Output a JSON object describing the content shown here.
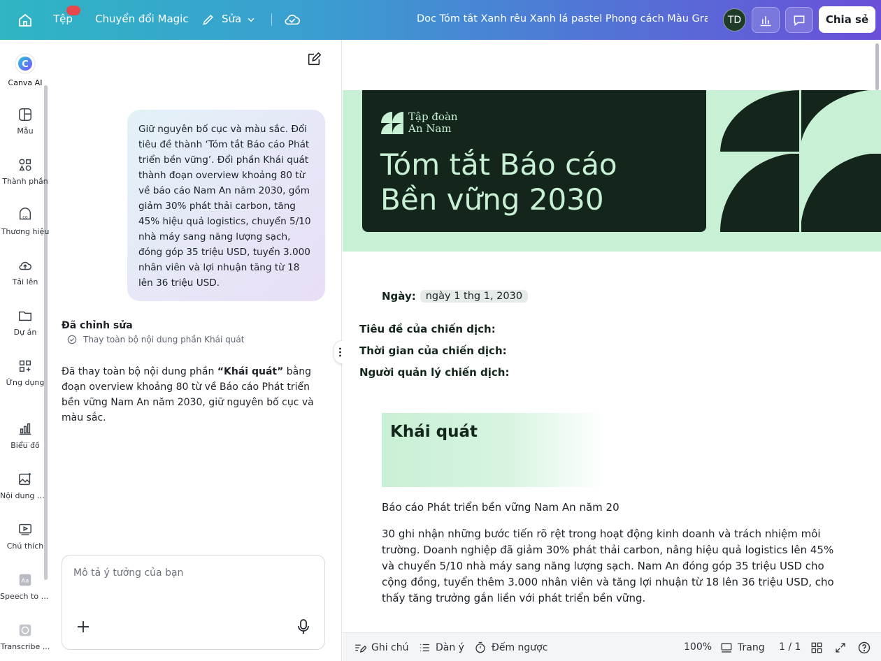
{
  "topbar": {
    "file": "Tệp",
    "magic": "Chuyển đổi Magic",
    "edit": "Sửa",
    "doc_title": "Doc Tóm tắt Xanh rêu Xanh lá pastel Phong cách Màu Gradi...",
    "avatar": "TD",
    "share": "Chia sẻ"
  },
  "rail": {
    "items": [
      {
        "label": "Canva AI"
      },
      {
        "label": "Mẫu"
      },
      {
        "label": "Thành phần"
      },
      {
        "label": "Thương hiệu"
      },
      {
        "label": "Tải lên"
      },
      {
        "label": "Dự án"
      },
      {
        "label": "Ứng dụng"
      },
      {
        "label": "Biểu đồ"
      },
      {
        "label": "Nội dung M..."
      },
      {
        "label": "Chú thích"
      },
      {
        "label": "Speech to T..."
      },
      {
        "label": "Transcribe ..."
      }
    ]
  },
  "chat": {
    "user_message": "Giữ nguyên bố cục và màu sắc. Đổi tiêu đề thành ‘Tóm tắt Báo cáo Phát triển bền vững’. Đổi phần Khái quát thành đoạn overview khoảng 80 từ về báo cáo Nam An năm 2030, gồm giảm 30% phát thải carbon, tăng 45% hiệu quả logistics, chuyển 5/10 nhà máy sang năng lượng sạch, đóng góp 35 triệu USD, tuyển 3.000 nhân viên và lợi nhuận tăng từ 18 lên 36 triệu USD.",
    "edited_title": "Đã chỉnh sửa",
    "edited_step": "Thay toàn bộ nội dung phần Khái quát",
    "reply_prefix": "Đã thay toàn bộ nội dung phần ",
    "reply_bold": "“Khái quát”",
    "reply_suffix": " bằng đoạn overview khoảng 80 từ về Báo cáo Phát triển bền vững Nam An năm 2030, giữ nguyên bố cục và màu sắc.",
    "composer_placeholder": "Mô tả ý tưởng của bạn"
  },
  "doc": {
    "company_line1": "Tập đoàn",
    "company_line2": "An Nam",
    "title_line1": "Tóm tắt Báo cáo",
    "title_line2": "Bền vững 2030",
    "date_label": "Ngày",
    "date_value": "ngày 1 thg 1, 2030",
    "field_campaign_title": "Tiêu đề của chiến dịch:",
    "field_campaign_time": "Thời gian của chiến dịch:",
    "field_campaign_manager": "Người quản lý chiến dịch:",
    "section_heading": "Khái quát",
    "para1": "Báo cáo Phát triển bền vững Nam An năm 20",
    "para2": "30 ghi nhận những bước tiến rõ rệt trong hoạt động kinh doanh và trách nhiệm môi trường. Doanh nghiệp đã giảm 30% phát thải carbon, nâng hiệu quả logistics lên 45% và chuyển 5/10 nhà máy sang năng lượng sạch. Nam An đóng góp 35 triệu USD cho cộng đồng, tuyển thêm 3.000 nhân viên và tăng lợi nhuận từ 18 lên 36 triệu USD, cho thấy tăng trưởng gắn liền với phát triển bền vững."
  },
  "bottombar": {
    "notes": "Ghi chú",
    "outline": "Dàn ý",
    "timer": "Đếm ngược",
    "zoom": "100%",
    "page_label": "Trang",
    "page_count": "1 / 1"
  },
  "colors": {
    "hero_dark": "#14261c",
    "hero_mint": "#c8f0d5",
    "accent_gradient_start": "#2fb5c4",
    "accent_gradient_end": "#6b4fd8"
  }
}
